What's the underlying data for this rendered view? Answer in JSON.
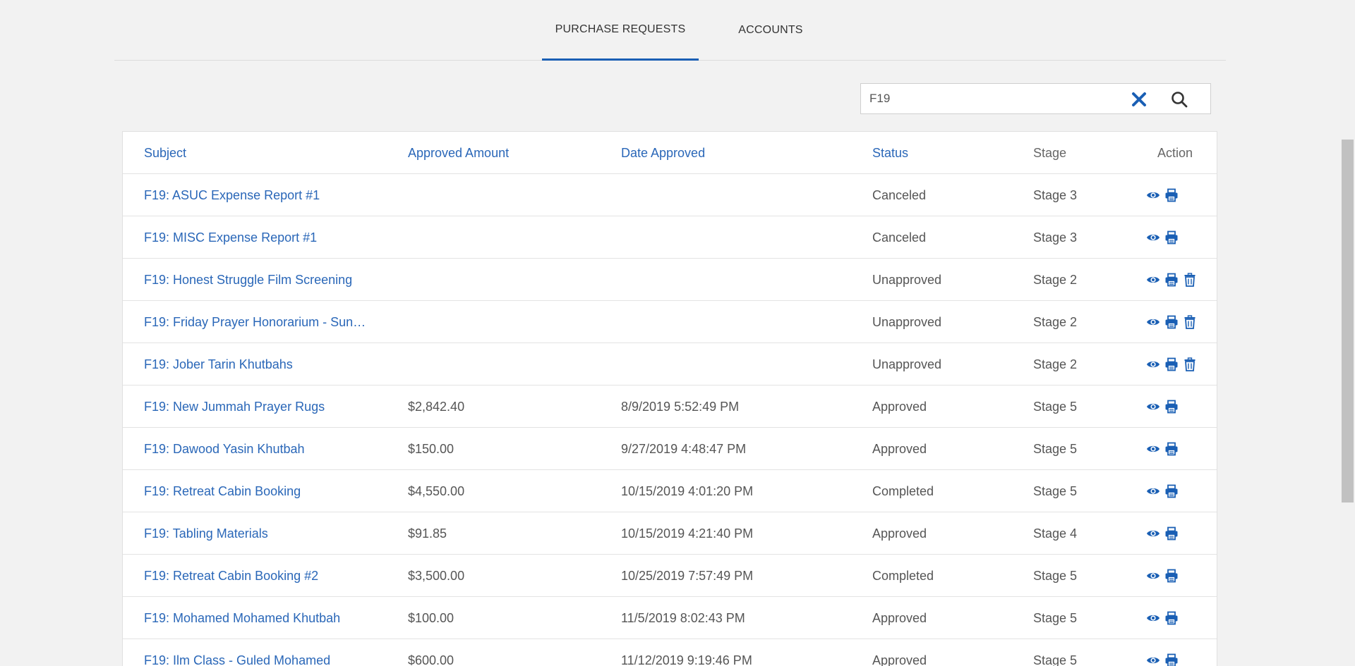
{
  "tabs": [
    {
      "label": "PURCHASE REQUESTS",
      "active": true
    },
    {
      "label": "ACCOUNTS",
      "active": false
    }
  ],
  "search": {
    "value": "F19",
    "clear_icon": "close-icon",
    "submit_icon": "search-icon"
  },
  "table": {
    "headers": {
      "subject": "Subject",
      "approved_amount": "Approved Amount",
      "date_approved": "Date Approved",
      "status": "Status",
      "stage": "Stage",
      "action": "Action"
    },
    "rows": [
      {
        "subject": "F19: ASUC Expense Report #1",
        "amount": "",
        "date": "",
        "status": "Canceled",
        "stage": "Stage 3",
        "actions": [
          "eye-icon",
          "print-icon"
        ]
      },
      {
        "subject": "F19: MISC Expense Report #1",
        "amount": "",
        "date": "",
        "status": "Canceled",
        "stage": "Stage 3",
        "actions": [
          "eye-icon",
          "print-icon"
        ]
      },
      {
        "subject": "F19: Honest Struggle Film Screening",
        "amount": "",
        "date": "",
        "status": "Unapproved",
        "stage": "Stage 2",
        "actions": [
          "eye-icon",
          "print-icon",
          "trash-icon"
        ]
      },
      {
        "subject": "F19: Friday Prayer Honorarium - Sun…",
        "amount": "",
        "date": "",
        "status": "Unapproved",
        "stage": "Stage 2",
        "actions": [
          "eye-icon",
          "print-icon",
          "trash-icon"
        ]
      },
      {
        "subject": "F19: Jober Tarin Khutbahs",
        "amount": "",
        "date": "",
        "status": "Unapproved",
        "stage": "Stage 2",
        "actions": [
          "eye-icon",
          "print-icon",
          "trash-icon"
        ]
      },
      {
        "subject": "F19: New Jummah Prayer Rugs",
        "amount": "$2,842.40",
        "date": "8/9/2019 5:52:49 PM",
        "status": "Approved",
        "stage": "Stage 5",
        "actions": [
          "eye-icon",
          "print-icon"
        ]
      },
      {
        "subject": "F19: Dawood Yasin Khutbah",
        "amount": "$150.00",
        "date": "9/27/2019 4:48:47 PM",
        "status": "Approved",
        "stage": "Stage 5",
        "actions": [
          "eye-icon",
          "print-icon"
        ]
      },
      {
        "subject": "F19: Retreat Cabin Booking",
        "amount": "$4,550.00",
        "date": "10/15/2019 4:01:20 PM",
        "status": "Completed",
        "stage": "Stage 5",
        "actions": [
          "eye-icon",
          "print-icon"
        ]
      },
      {
        "subject": "F19: Tabling Materials",
        "amount": "$91.85",
        "date": "10/15/2019 4:21:40 PM",
        "status": "Approved",
        "stage": "Stage 4",
        "actions": [
          "eye-icon",
          "print-icon"
        ]
      },
      {
        "subject": "F19: Retreat Cabin Booking #2",
        "amount": "$3,500.00",
        "date": "10/25/2019 7:57:49 PM",
        "status": "Completed",
        "stage": "Stage 5",
        "actions": [
          "eye-icon",
          "print-icon"
        ]
      },
      {
        "subject": "F19: Mohamed Mohamed Khutbah",
        "amount": "$100.00",
        "date": "11/5/2019 8:02:43 PM",
        "status": "Approved",
        "stage": "Stage 5",
        "actions": [
          "eye-icon",
          "print-icon"
        ]
      },
      {
        "subject": "F19: Ilm Class - Guled Mohamed",
        "amount": "$600.00",
        "date": "11/12/2019 9:19:46 PM",
        "status": "Approved",
        "stage": "Stage 5",
        "actions": [
          "eye-icon",
          "print-icon"
        ]
      }
    ]
  },
  "colors": {
    "accent": "#1a5fb4",
    "link": "#2a67b8",
    "text": "#555555",
    "background": "#f2f2f2"
  }
}
